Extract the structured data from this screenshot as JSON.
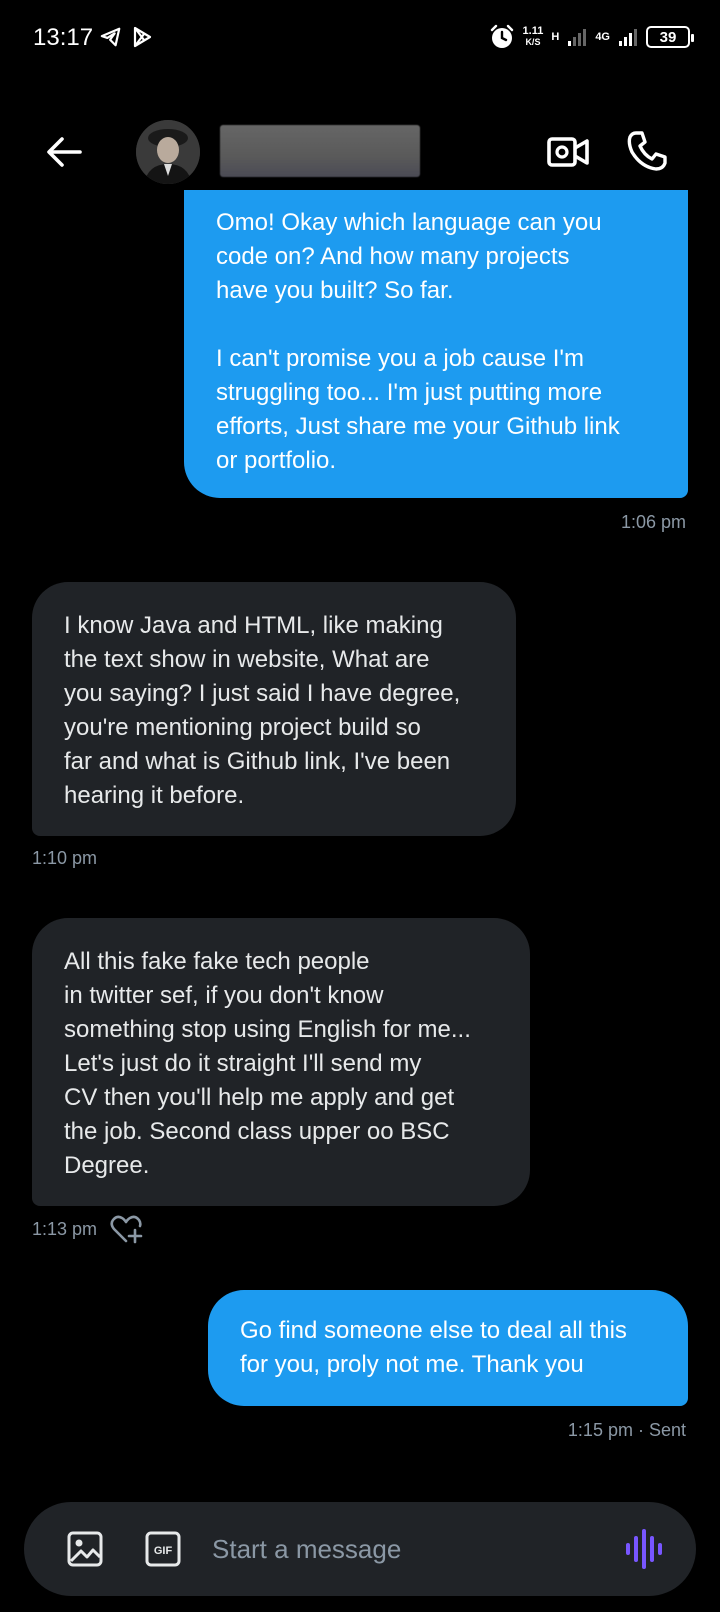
{
  "status_bar": {
    "time": "13:17",
    "net_speed_value": "1.11",
    "net_speed_unit": "K/S",
    "signal_1_label": "H",
    "signal_2_label": "4G",
    "battery": "39"
  },
  "header": {
    "contact_name": ""
  },
  "messages": [
    {
      "direction": "sent",
      "text": "Omo! Okay which language can you\ncode on? And how many projects\nhave you built? So far.\n\nI can't promise you a job cause I'm\nstruggling too... I'm just putting more\nefforts, Just share me your Github link\nor portfolio.",
      "time": "1:06 pm"
    },
    {
      "direction": "received",
      "text": "I know Java and HTML, like making\nthe text show in website, What are\nyou saying? I just said I have degree,\nyou're mentioning project build so\nfar and what is Github link, I've been\nhearing it before.",
      "time": "1:10 pm"
    },
    {
      "direction": "received",
      "text": "All this fake fake tech people\nin twitter sef, if you don't know\nsomething stop using English for me...\nLet's just do it straight I'll send my\nCV then you'll help me apply and get\nthe job. Second class upper oo BSC\nDegree.",
      "time": "1:13 pm"
    },
    {
      "direction": "sent",
      "text": "Go find someone else to deal all this\nfor you, proly not me. Thank you",
      "time": "1:15 pm · Sent"
    }
  ],
  "composer": {
    "placeholder": "Start a message"
  },
  "colors": {
    "sent_bubble": "#1d9bf0",
    "received_bubble": "#202327",
    "timestamp": "#8b98a5",
    "voice_accent": "#7856ff"
  },
  "icons": [
    "telegram-icon",
    "play-store-icon",
    "alarm-icon",
    "back-arrow-icon",
    "video-call-icon",
    "phone-call-icon",
    "heart-plus-icon",
    "image-icon",
    "gif-icon",
    "voice-message-icon"
  ]
}
